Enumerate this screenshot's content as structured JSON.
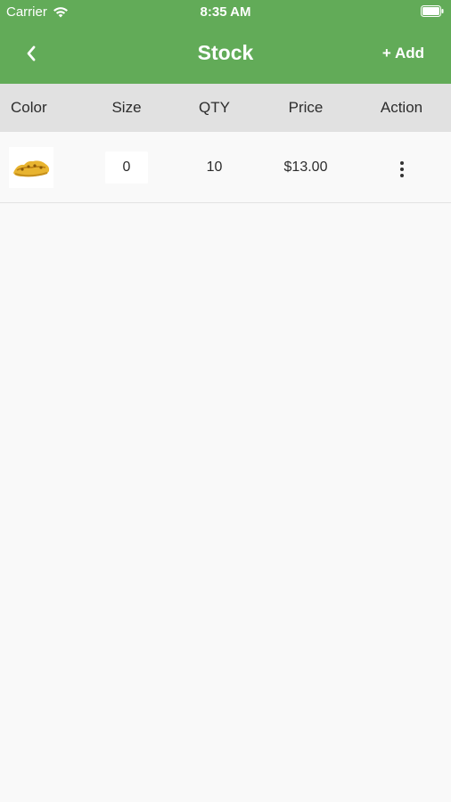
{
  "status_bar": {
    "carrier": "Carrier",
    "time": "8:35 AM",
    "wifi_icon": "wifi-icon",
    "battery_icon": "battery-icon"
  },
  "nav_bar": {
    "title": "Stock",
    "back_icon": "chevron-left-icon",
    "add_label": "+ Add",
    "background_color": "#62ab58"
  },
  "table": {
    "columns": [
      "Color",
      "Size",
      "QTY",
      "Price",
      "Action"
    ],
    "rows": [
      {
        "color_image": "yellow-shoe-thumbnail",
        "size": "0",
        "qty": "10",
        "price": "$13.00",
        "action_icon": "more-vertical-icon"
      }
    ]
  }
}
